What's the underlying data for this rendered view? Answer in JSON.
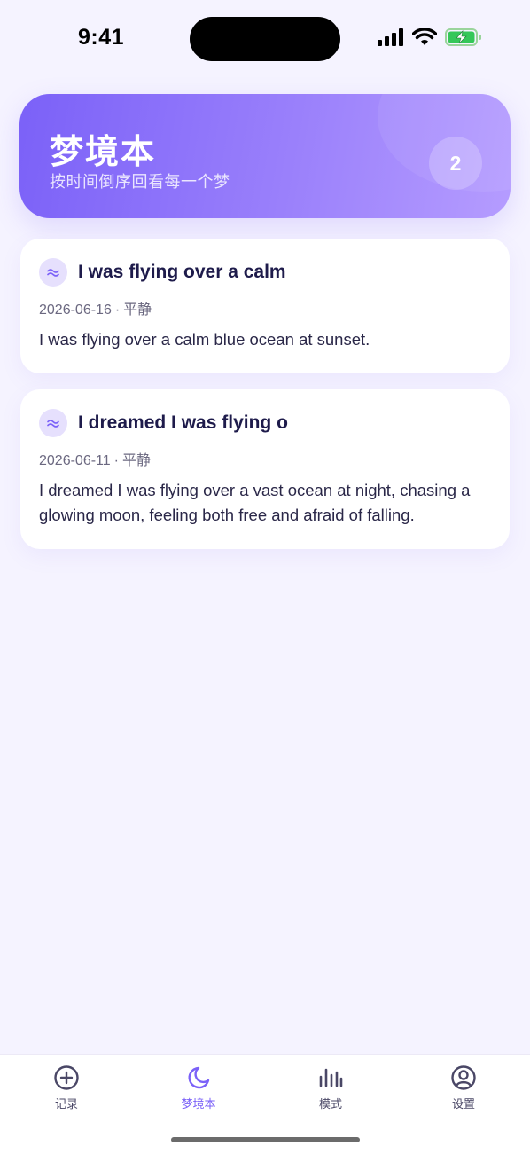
{
  "status_bar": {
    "time": "9:41"
  },
  "header": {
    "title": "梦境本",
    "subtitle": "按时间倒序回看每一个梦",
    "count": "2"
  },
  "dreams": [
    {
      "title": "I was flying over a calm",
      "date": "2026-06-16",
      "separator": "·",
      "mood": "平静",
      "body": "I was flying over a calm blue ocean at sunset.",
      "mood_icon": "wave-approx-icon"
    },
    {
      "title": "I dreamed I was flying o",
      "date": "2026-06-11",
      "separator": "·",
      "mood": "平静",
      "body": "I dreamed I was flying over a vast ocean at night, chasing a glowing moon, feeling both free and afraid of falling.",
      "mood_icon": "wave-approx-icon"
    }
  ],
  "tab_bar": {
    "tabs": [
      {
        "label": "记录",
        "icon": "plus-circle-icon",
        "active": false
      },
      {
        "label": "梦境本",
        "icon": "moon-icon",
        "active": true
      },
      {
        "label": "模式",
        "icon": "bar-chart-icon",
        "active": false
      },
      {
        "label": "设置",
        "icon": "user-circle-icon",
        "active": false
      }
    ]
  },
  "colors": {
    "accent": "#7b61f8",
    "background": "#f5f3ff",
    "text_primary": "#1e1b4b",
    "text_secondary": "#6b6880"
  }
}
